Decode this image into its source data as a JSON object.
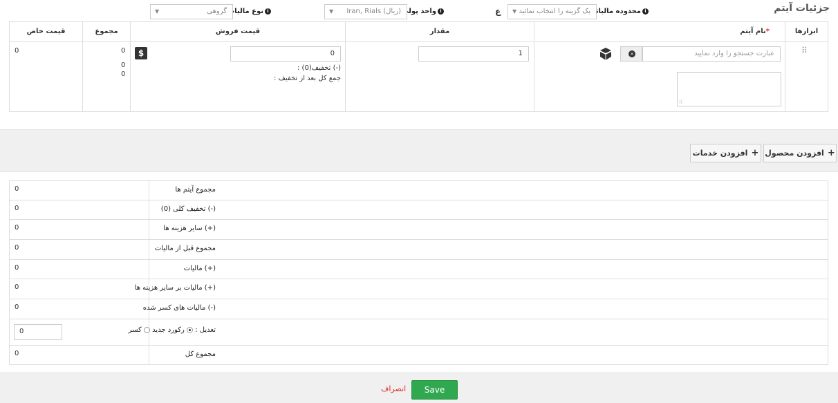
{
  "header": {
    "title": "جزئیات آیتم",
    "tax_region_label": "محدوده مالیاتی",
    "tax_region_placeholder": "یک گزینه را انتخاب نمائید",
    "currency_label": "واحد پولی",
    "currency_value": "Iran, Rials (ریال)",
    "tax_type_label": "نوع مالیات",
    "tax_type_value": "گروهی"
  },
  "items_table": {
    "columns": {
      "tools": "ابزارها",
      "item_name": "نام آیتم",
      "required_mark": "*",
      "quantity": "مقدار",
      "sell_price": "قیمت فروش",
      "total": "مجموع",
      "net_price": "قیمت خاص"
    },
    "row": {
      "search_placeholder": "عبارت جستجو را وارد نمایید",
      "quantity": "1",
      "price": "0",
      "discount_label": "(-) تخفیف(0) :",
      "after_discount_label": "جمع کل بعد از تخفیف :",
      "total_values": [
        "0",
        "0",
        "0"
      ],
      "net_price": "0"
    }
  },
  "actions": {
    "add_product": "افزودن محصول",
    "add_service": "افزودن خدمات"
  },
  "summary": {
    "rows": [
      {
        "label": "مجموع آیتم ها",
        "value": "0"
      },
      {
        "label": "(-) تخفیف کلی (0)",
        "value": "0"
      },
      {
        "label": "(+) سایر هزینه ها",
        "value": "0"
      },
      {
        "label": "مجموع قبل از مالیات",
        "value": "0"
      },
      {
        "label": "(+) مالیات",
        "value": "0"
      },
      {
        "label": "(+) مالیات بر سایر هزینه ها",
        "value": "0"
      },
      {
        "label": "(-) مالیات های کسر شده",
        "value": "0"
      }
    ],
    "adjustment_label": "تعدیل :",
    "adjustment_option_add": "رکورد جدید",
    "adjustment_option_deduct": "کسر",
    "adjustment_value": "0",
    "grand_total_label": "مجموع کل",
    "grand_total_value": "0"
  },
  "footer": {
    "save": "Save",
    "cancel": "انصراف"
  }
}
